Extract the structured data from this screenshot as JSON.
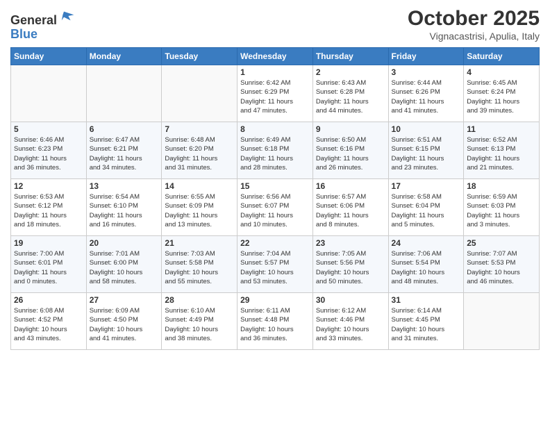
{
  "header": {
    "logo_line1": "General",
    "logo_line2": "Blue",
    "month": "October 2025",
    "location": "Vignacastrisi, Apulia, Italy"
  },
  "weekdays": [
    "Sunday",
    "Monday",
    "Tuesday",
    "Wednesday",
    "Thursday",
    "Friday",
    "Saturday"
  ],
  "weeks": [
    [
      {
        "day": "",
        "info": ""
      },
      {
        "day": "",
        "info": ""
      },
      {
        "day": "",
        "info": ""
      },
      {
        "day": "1",
        "info": "Sunrise: 6:42 AM\nSunset: 6:29 PM\nDaylight: 11 hours\nand 47 minutes."
      },
      {
        "day": "2",
        "info": "Sunrise: 6:43 AM\nSunset: 6:28 PM\nDaylight: 11 hours\nand 44 minutes."
      },
      {
        "day": "3",
        "info": "Sunrise: 6:44 AM\nSunset: 6:26 PM\nDaylight: 11 hours\nand 41 minutes."
      },
      {
        "day": "4",
        "info": "Sunrise: 6:45 AM\nSunset: 6:24 PM\nDaylight: 11 hours\nand 39 minutes."
      }
    ],
    [
      {
        "day": "5",
        "info": "Sunrise: 6:46 AM\nSunset: 6:23 PM\nDaylight: 11 hours\nand 36 minutes."
      },
      {
        "day": "6",
        "info": "Sunrise: 6:47 AM\nSunset: 6:21 PM\nDaylight: 11 hours\nand 34 minutes."
      },
      {
        "day": "7",
        "info": "Sunrise: 6:48 AM\nSunset: 6:20 PM\nDaylight: 11 hours\nand 31 minutes."
      },
      {
        "day": "8",
        "info": "Sunrise: 6:49 AM\nSunset: 6:18 PM\nDaylight: 11 hours\nand 28 minutes."
      },
      {
        "day": "9",
        "info": "Sunrise: 6:50 AM\nSunset: 6:16 PM\nDaylight: 11 hours\nand 26 minutes."
      },
      {
        "day": "10",
        "info": "Sunrise: 6:51 AM\nSunset: 6:15 PM\nDaylight: 11 hours\nand 23 minutes."
      },
      {
        "day": "11",
        "info": "Sunrise: 6:52 AM\nSunset: 6:13 PM\nDaylight: 11 hours\nand 21 minutes."
      }
    ],
    [
      {
        "day": "12",
        "info": "Sunrise: 6:53 AM\nSunset: 6:12 PM\nDaylight: 11 hours\nand 18 minutes."
      },
      {
        "day": "13",
        "info": "Sunrise: 6:54 AM\nSunset: 6:10 PM\nDaylight: 11 hours\nand 16 minutes."
      },
      {
        "day": "14",
        "info": "Sunrise: 6:55 AM\nSunset: 6:09 PM\nDaylight: 11 hours\nand 13 minutes."
      },
      {
        "day": "15",
        "info": "Sunrise: 6:56 AM\nSunset: 6:07 PM\nDaylight: 11 hours\nand 10 minutes."
      },
      {
        "day": "16",
        "info": "Sunrise: 6:57 AM\nSunset: 6:06 PM\nDaylight: 11 hours\nand 8 minutes."
      },
      {
        "day": "17",
        "info": "Sunrise: 6:58 AM\nSunset: 6:04 PM\nDaylight: 11 hours\nand 5 minutes."
      },
      {
        "day": "18",
        "info": "Sunrise: 6:59 AM\nSunset: 6:03 PM\nDaylight: 11 hours\nand 3 minutes."
      }
    ],
    [
      {
        "day": "19",
        "info": "Sunrise: 7:00 AM\nSunset: 6:01 PM\nDaylight: 11 hours\nand 0 minutes."
      },
      {
        "day": "20",
        "info": "Sunrise: 7:01 AM\nSunset: 6:00 PM\nDaylight: 10 hours\nand 58 minutes."
      },
      {
        "day": "21",
        "info": "Sunrise: 7:03 AM\nSunset: 5:58 PM\nDaylight: 10 hours\nand 55 minutes."
      },
      {
        "day": "22",
        "info": "Sunrise: 7:04 AM\nSunset: 5:57 PM\nDaylight: 10 hours\nand 53 minutes."
      },
      {
        "day": "23",
        "info": "Sunrise: 7:05 AM\nSunset: 5:56 PM\nDaylight: 10 hours\nand 50 minutes."
      },
      {
        "day": "24",
        "info": "Sunrise: 7:06 AM\nSunset: 5:54 PM\nDaylight: 10 hours\nand 48 minutes."
      },
      {
        "day": "25",
        "info": "Sunrise: 7:07 AM\nSunset: 5:53 PM\nDaylight: 10 hours\nand 46 minutes."
      }
    ],
    [
      {
        "day": "26",
        "info": "Sunrise: 6:08 AM\nSunset: 4:52 PM\nDaylight: 10 hours\nand 43 minutes."
      },
      {
        "day": "27",
        "info": "Sunrise: 6:09 AM\nSunset: 4:50 PM\nDaylight: 10 hours\nand 41 minutes."
      },
      {
        "day": "28",
        "info": "Sunrise: 6:10 AM\nSunset: 4:49 PM\nDaylight: 10 hours\nand 38 minutes."
      },
      {
        "day": "29",
        "info": "Sunrise: 6:11 AM\nSunset: 4:48 PM\nDaylight: 10 hours\nand 36 minutes."
      },
      {
        "day": "30",
        "info": "Sunrise: 6:12 AM\nSunset: 4:46 PM\nDaylight: 10 hours\nand 33 minutes."
      },
      {
        "day": "31",
        "info": "Sunrise: 6:14 AM\nSunset: 4:45 PM\nDaylight: 10 hours\nand 31 minutes."
      },
      {
        "day": "",
        "info": ""
      }
    ]
  ]
}
